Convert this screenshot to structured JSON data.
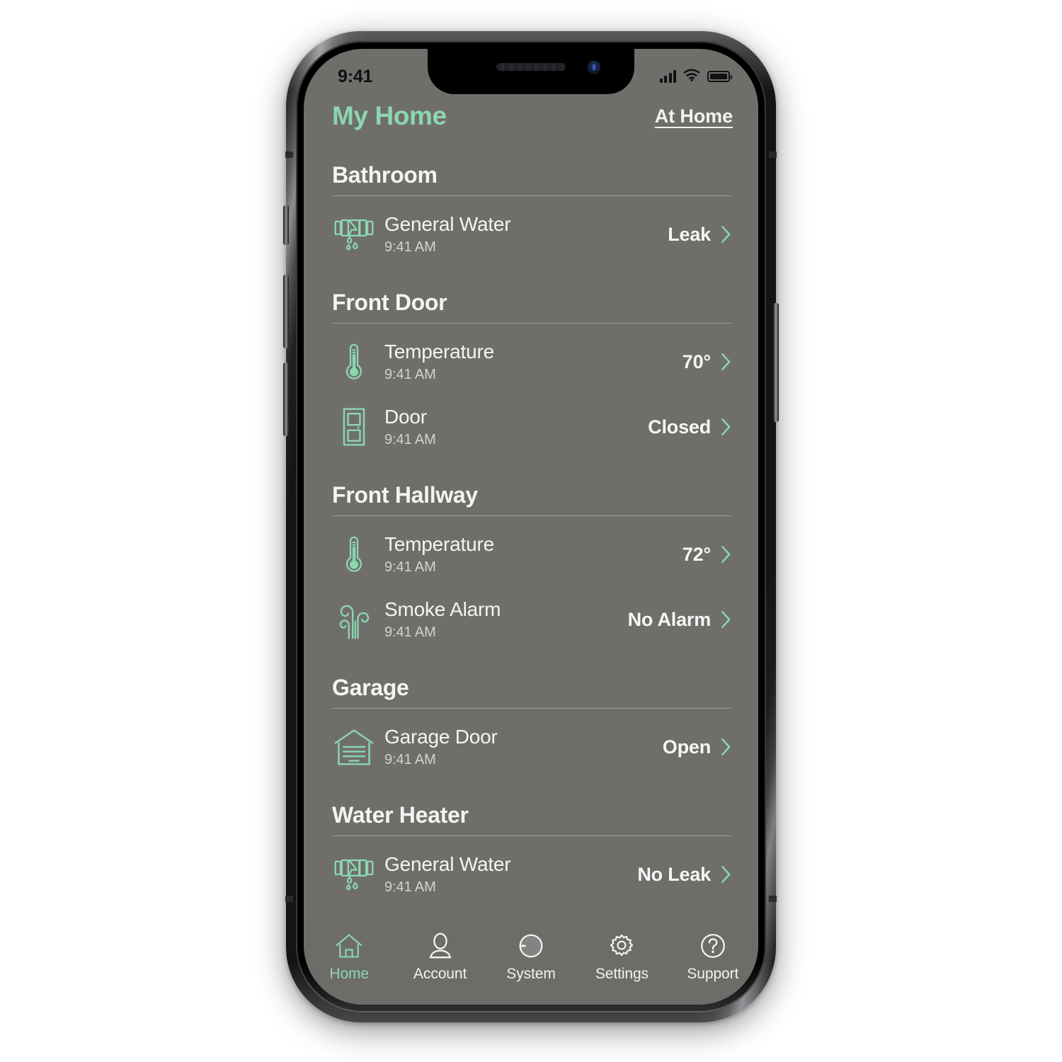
{
  "device": {
    "status_bar": {
      "clock": "9:41",
      "icons": [
        "cellular-signal-icon",
        "wifi-icon",
        "battery-icon"
      ]
    },
    "notch_elements": [
      "earpiece-speaker",
      "front-camera"
    ],
    "hardware_buttons": [
      "silent-switch",
      "volume-up-button",
      "volume-down-button",
      "power-button"
    ]
  },
  "colors": {
    "accent_green": "#8bd6b0",
    "screen_background": "#706e6b",
    "text_primary": "#f4f4f2",
    "text_secondary": "#d3d2cf",
    "rule": "#9d9b98",
    "tabbar_background": "#6e6c69"
  },
  "header": {
    "title": "My Home",
    "status_link": "At Home"
  },
  "sections": [
    {
      "title": "Bathroom",
      "devices": [
        {
          "icon": "water-pipe-leak-icon",
          "name": "General Water",
          "time": "9:41 AM",
          "value": "Leak",
          "chevron": "chevron-right-icon"
        }
      ]
    },
    {
      "title": "Front Door",
      "devices": [
        {
          "icon": "thermometer-icon",
          "name": "Temperature",
          "time": "9:41 AM",
          "value": "70°",
          "chevron": "chevron-right-icon"
        },
        {
          "icon": "door-icon",
          "name": "Door",
          "time": "9:41 AM",
          "value": "Closed",
          "chevron": "chevron-right-icon"
        }
      ]
    },
    {
      "title": "Front Hallway",
      "devices": [
        {
          "icon": "thermometer-icon",
          "name": "Temperature",
          "time": "9:41 AM",
          "value": "72°",
          "chevron": "chevron-right-icon"
        },
        {
          "icon": "smoke-alarm-icon",
          "name": "Smoke Alarm",
          "time": "9:41 AM",
          "value": "No Alarm",
          "chevron": "chevron-right-icon"
        }
      ]
    },
    {
      "title": "Garage",
      "devices": [
        {
          "icon": "garage-door-icon",
          "name": "Garage Door",
          "time": "9:41 AM",
          "value": "Open",
          "chevron": "chevron-right-icon"
        }
      ]
    },
    {
      "title": "Water Heater",
      "devices": [
        {
          "icon": "water-pipe-leak-icon",
          "name": "General Water",
          "time": "9:41 AM",
          "value": "No Leak",
          "chevron": "chevron-right-icon"
        }
      ]
    }
  ],
  "tabbar": {
    "items": [
      {
        "icon": "home-icon",
        "label": "Home",
        "active": true
      },
      {
        "icon": "person-icon",
        "label": "Account",
        "active": false
      },
      {
        "icon": "system-dial-icon",
        "label": "System",
        "active": false
      },
      {
        "icon": "gear-icon",
        "label": "Settings",
        "active": false
      },
      {
        "icon": "question-circle-icon",
        "label": "Support",
        "active": false
      }
    ]
  }
}
